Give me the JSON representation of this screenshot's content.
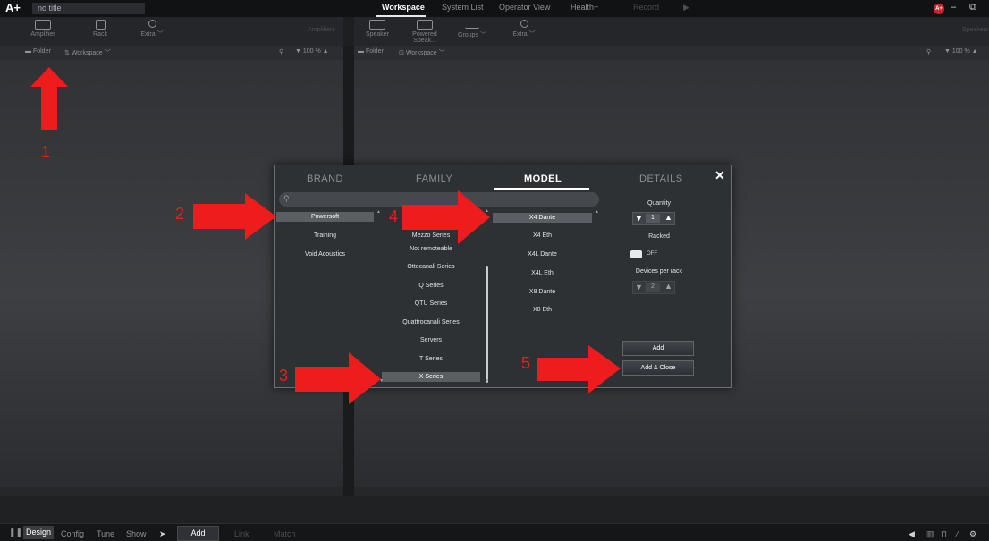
{
  "titlebar": {
    "logo": "A+",
    "doc_title": "no title",
    "nav": [
      "Workspace",
      "System List",
      "Operator View",
      "Health+",
      "Record"
    ],
    "avatar": "A+",
    "win_min": "–",
    "win_restore": "⧉"
  },
  "left_toolbar": {
    "tools": [
      "Amplifier",
      "Rack",
      "Extra"
    ],
    "section": "Amplifiers"
  },
  "right_toolbar": {
    "tools": [
      "Speaker",
      "Powered Speak...",
      "Groups",
      "Extra"
    ],
    "section": "Speakers"
  },
  "left_pane": {
    "folder": "Folder",
    "workspace": "Workspace",
    "zoom": "100 %"
  },
  "right_pane": {
    "folder": "Folder",
    "workspace": "Workspace",
    "zoom": "100 %"
  },
  "modal": {
    "tabs": [
      "BRAND",
      "FAMILY",
      "MODEL",
      "DETAILS"
    ],
    "active_tab": "MODEL",
    "close": "✕",
    "brands": [
      "Powersoft",
      "Training",
      "Void Acoustics"
    ],
    "selected_brand": "Powersoft",
    "families": [
      "Mezzo Series",
      "Not remoteable",
      "Ottocanali Series",
      "Q Series",
      "QTU Series",
      "Quattrocanali Series",
      "Servers",
      "T Series",
      "X Series"
    ],
    "selected_family": "X Series",
    "models": [
      "X4 Dante",
      "X4 Eth",
      "X4L Dante",
      "X4L Eth",
      "X8 Dante",
      "X8 Eth"
    ],
    "selected_model": "X4 Dante",
    "details": {
      "quantity_label": "Quantity",
      "quantity": "1",
      "racked_label": "Racked",
      "racked_value": "OFF",
      "devices_per_rack_label": "Devices per rack",
      "devices_per_rack": "2",
      "add": "Add",
      "add_close": "Add & Close"
    }
  },
  "bottombar": {
    "modes": [
      "Design",
      "Config",
      "Tune",
      "Show"
    ],
    "active_mode": "Design",
    "actions": [
      "Add",
      "Link",
      "Match"
    ],
    "active_action": "Add"
  },
  "annotations": [
    "1",
    "2",
    "3",
    "4",
    "5"
  ],
  "colors": {
    "annotation": "#ee1c1c",
    "modal_bg": "#2e3134",
    "avatar": "#c9262b"
  }
}
